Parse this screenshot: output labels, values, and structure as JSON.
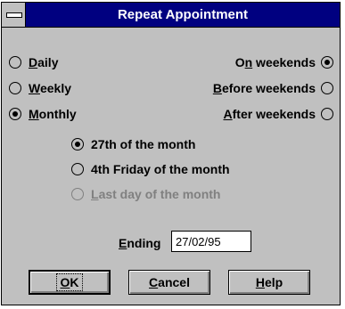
{
  "window": {
    "title": "Repeat Appointment"
  },
  "frequency": [
    {
      "prefix": "",
      "mnemonic": "D",
      "rest": "aily",
      "checked": false
    },
    {
      "prefix": "",
      "mnemonic": "W",
      "rest": "eekly",
      "checked": false
    },
    {
      "prefix": "",
      "mnemonic": "M",
      "rest": "onthly",
      "checked": true
    }
  ],
  "weekend": [
    {
      "prefix": "O",
      "mnemonic": "n",
      "rest": " weekends",
      "checked": true
    },
    {
      "prefix": "",
      "mnemonic": "B",
      "rest": "efore weekends",
      "checked": false
    },
    {
      "prefix": "",
      "mnemonic": "A",
      "rest": "fter weekends",
      "checked": false
    }
  ],
  "monthly_options": [
    {
      "label": "27th of the month",
      "checked": true,
      "disabled": false
    },
    {
      "label": "4th Friday of the month",
      "checked": false,
      "disabled": false
    },
    {
      "mnemonic": "L",
      "rest": "ast day of the month",
      "checked": false,
      "disabled": true
    }
  ],
  "ending": {
    "mnemonic": "E",
    "rest": "nding",
    "value": "27/02/95"
  },
  "buttons": {
    "ok": {
      "mnemonic": "O",
      "rest": "K"
    },
    "cancel": {
      "mnemonic": "C",
      "rest": "ancel"
    },
    "help": {
      "mnemonic": "H",
      "rest": "elp"
    }
  },
  "icons": {
    "system_menu": "system-menu-icon",
    "radio": "radio-circle"
  }
}
